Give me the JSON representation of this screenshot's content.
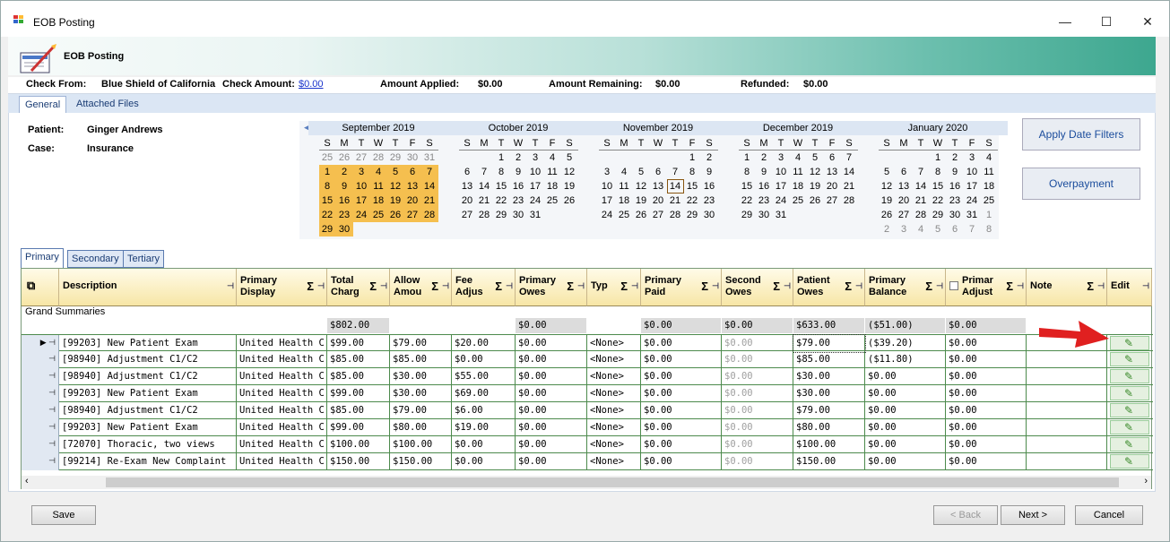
{
  "window": {
    "title": "EOB Posting",
    "minimize": "—",
    "maximize": "☐",
    "close": "✕"
  },
  "header": {
    "title": "EOB Posting"
  },
  "checkbar": {
    "check_from_label": "Check From:",
    "check_from_value": "Blue Shield of California",
    "check_amount_label": "Check Amount:",
    "check_amount_value": "$0.00",
    "applied_label": "Amount Applied:",
    "applied_value": "$0.00",
    "remaining_label": "Amount Remaining:",
    "remaining_value": "$0.00",
    "refunded_label": "Refunded:",
    "refunded_value": "$0.00"
  },
  "top_tabs": [
    "General",
    "Attached Files"
  ],
  "patient": {
    "patient_label": "Patient:",
    "patient_value": "Ginger Andrews",
    "case_label": "Case:",
    "case_value": "Insurance"
  },
  "calendar": {
    "day_headers": [
      "S",
      "M",
      "T",
      "W",
      "T",
      "F",
      "S"
    ],
    "months": [
      {
        "name": "September 2019",
        "days": [
          "25",
          "26",
          "27",
          "28",
          "29",
          "30",
          "31",
          "1",
          "2",
          "3",
          "4",
          "5",
          "6",
          "7",
          "8",
          "9",
          "10",
          "11",
          "12",
          "13",
          "14",
          "15",
          "16",
          "17",
          "18",
          "19",
          "20",
          "21",
          "22",
          "23",
          "24",
          "25",
          "26",
          "27",
          "28",
          "29",
          "30"
        ],
        "lead_other": 7,
        "selected_from": 7,
        "selected_to": 36
      },
      {
        "name": "October 2019",
        "days": [
          "",
          "",
          "1",
          "2",
          "3",
          "4",
          "5",
          "6",
          "7",
          "8",
          "9",
          "10",
          "11",
          "12",
          "13",
          "14",
          "15",
          "16",
          "17",
          "18",
          "19",
          "20",
          "21",
          "22",
          "23",
          "24",
          "25",
          "26",
          "27",
          "28",
          "29",
          "30",
          "31"
        ],
        "lead_other": 0
      },
      {
        "name": "November 2019",
        "days": [
          "",
          "",
          "",
          "",
          "",
          "1",
          "2",
          "3",
          "4",
          "5",
          "6",
          "7",
          "8",
          "9",
          "10",
          "11",
          "12",
          "13",
          "14",
          "15",
          "16",
          "17",
          "18",
          "19",
          "20",
          "21",
          "22",
          "23",
          "24",
          "25",
          "26",
          "27",
          "28",
          "29",
          "30"
        ],
        "lead_other": 0,
        "today_index": 18
      },
      {
        "name": "December 2019",
        "days": [
          "1",
          "2",
          "3",
          "4",
          "5",
          "6",
          "7",
          "8",
          "9",
          "10",
          "11",
          "12",
          "13",
          "14",
          "15",
          "16",
          "17",
          "18",
          "19",
          "20",
          "21",
          "22",
          "23",
          "24",
          "25",
          "26",
          "27",
          "28",
          "29",
          "30",
          "31"
        ],
        "lead_other": 0
      },
      {
        "name": "January 2020",
        "days": [
          "",
          "",
          "",
          "1",
          "2",
          "3",
          "4",
          "5",
          "6",
          "7",
          "8",
          "9",
          "10",
          "11",
          "12",
          "13",
          "14",
          "15",
          "16",
          "17",
          "18",
          "19",
          "20",
          "21",
          "22",
          "23",
          "24",
          "25",
          "26",
          "27",
          "28",
          "29",
          "30",
          "31",
          "1",
          "2",
          "3",
          "4",
          "5",
          "6",
          "7",
          "8"
        ],
        "lead_other": 0,
        "trail_other_from": 34
      }
    ]
  },
  "side_buttons": {
    "apply": "Apply Date Filters",
    "overpayment": "Overpayment"
  },
  "grid_tabs": [
    "Primary",
    "Secondary",
    "Tertiary"
  ],
  "columns": [
    {
      "label": "Description",
      "sigma": false
    },
    {
      "label": "Primary Display",
      "sigma": true
    },
    {
      "label": "Total Charg",
      "sigma": true
    },
    {
      "label": "Allow Amou",
      "sigma": true
    },
    {
      "label": "Fee Adjus",
      "sigma": true
    },
    {
      "label": "Primary Owes",
      "sigma": true
    },
    {
      "label": "Typ",
      "sigma": true
    },
    {
      "label": "Primary Paid",
      "sigma": true
    },
    {
      "label": "Second Owes",
      "sigma": true
    },
    {
      "label": "Patient Owes",
      "sigma": true
    },
    {
      "label": "Primary Balance",
      "sigma": true
    },
    {
      "label": "Primar Adjust",
      "sigma": true
    },
    {
      "label": "Note",
      "sigma": true
    },
    {
      "label": "Edit",
      "sigma": false
    }
  ],
  "summary_label": "Grand Summaries",
  "summary": [
    "",
    "",
    "$802.00",
    "",
    "",
    "$0.00",
    "",
    "$0.00",
    "$0.00",
    "$633.00",
    "($51.00)",
    "$0.00",
    "",
    ""
  ],
  "rows": [
    [
      "[99203] New Patient Exam",
      "United Health C...",
      "$99.00",
      "$79.00",
      "$20.00",
      "$0.00",
      "<None>",
      "$0.00",
      "$0.00",
      "$79.00",
      "($39.20)",
      "$0.00",
      "",
      ""
    ],
    [
      "[98940] Adjustment C1/C2",
      "United Health C...",
      "$85.00",
      "$85.00",
      "$0.00",
      "$0.00",
      "<None>",
      "$0.00",
      "$0.00",
      "$85.00",
      "($11.80)",
      "$0.00",
      "",
      ""
    ],
    [
      "[98940] Adjustment C1/C2",
      "United Health C...",
      "$85.00",
      "$30.00",
      "$55.00",
      "$0.00",
      "<None>",
      "$0.00",
      "$0.00",
      "$30.00",
      "$0.00",
      "$0.00",
      "",
      ""
    ],
    [
      "[99203] New Patient Exam",
      "United Health C...",
      "$99.00",
      "$30.00",
      "$69.00",
      "$0.00",
      "<None>",
      "$0.00",
      "$0.00",
      "$30.00",
      "$0.00",
      "$0.00",
      "",
      ""
    ],
    [
      "[98940] Adjustment C1/C2",
      "United Health C...",
      "$85.00",
      "$79.00",
      "$6.00",
      "$0.00",
      "<None>",
      "$0.00",
      "$0.00",
      "$79.00",
      "$0.00",
      "$0.00",
      "",
      ""
    ],
    [
      "[99203] New Patient Exam",
      "United Health C...",
      "$99.00",
      "$80.00",
      "$19.00",
      "$0.00",
      "<None>",
      "$0.00",
      "$0.00",
      "$80.00",
      "$0.00",
      "$0.00",
      "",
      ""
    ],
    [
      "[72070] Thoracic, two views",
      "United Health C...",
      "$100.00",
      "$100.00",
      "$0.00",
      "$0.00",
      "<None>",
      "$0.00",
      "$0.00",
      "$100.00",
      "$0.00",
      "$0.00",
      "",
      ""
    ],
    [
      "[99214] Re-Exam New Complaint",
      "United Health C...",
      "$150.00",
      "$150.00",
      "$0.00",
      "$0.00",
      "<None>",
      "$0.00",
      "$0.00",
      "$150.00",
      "$0.00",
      "$0.00",
      "",
      ""
    ]
  ],
  "buttons": {
    "save": "Save",
    "back": "< Back",
    "next": "Next >",
    "cancel": "Cancel"
  },
  "colors": {
    "selected_day": "#f5bf4f",
    "header_grad_end": "#3da78f",
    "arrow": "#e02020"
  }
}
